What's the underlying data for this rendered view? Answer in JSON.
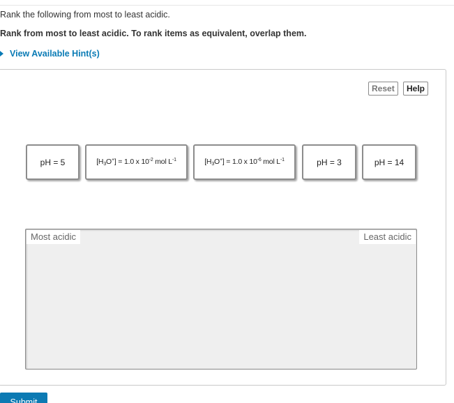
{
  "question": {
    "prompt": "Rank the following from most to least acidic.",
    "instruction": "Rank from most to least acidic. To rank items as equivalent, overlap them."
  },
  "hints": {
    "label": "View Available Hint(s)"
  },
  "toolbar": {
    "reset_label": "Reset",
    "help_label": "Help"
  },
  "items": [
    {
      "label": "pH = 5"
    },
    {
      "base": "[H",
      "sub": "3",
      "mid": "O",
      "sup": "+",
      "rest": "] = 1.0 x 10",
      "exp": "-2",
      "unit": " mol L",
      "unit_exp": "-1"
    },
    {
      "base": "[H",
      "sub": "3",
      "mid": "O",
      "sup": "+",
      "rest": "] = 1.0 x 10",
      "exp": "-6",
      "unit": " mol L",
      "unit_exp": "-1"
    },
    {
      "label": "pH = 3"
    },
    {
      "label": "pH = 14"
    }
  ],
  "ranking": {
    "left_label": "Most acidic",
    "right_label": "Least acidic"
  },
  "submit": {
    "label": "Submit"
  },
  "colors": {
    "accent": "#0a7bb5",
    "submit": "#0c7ab3",
    "zone": "#efefef"
  }
}
